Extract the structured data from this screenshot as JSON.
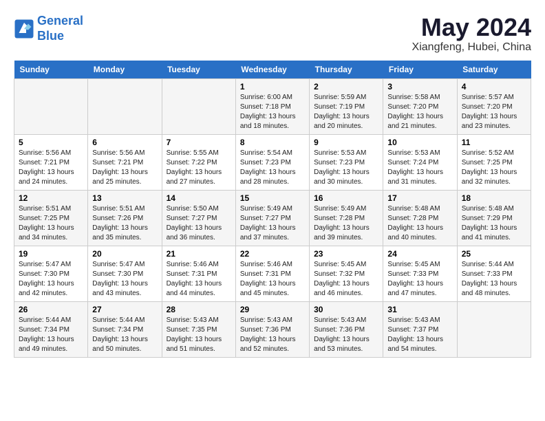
{
  "logo": {
    "line1": "General",
    "line2": "Blue"
  },
  "title": "May 2024",
  "subtitle": "Xiangfeng, Hubei, China",
  "weekdays": [
    "Sunday",
    "Monday",
    "Tuesday",
    "Wednesday",
    "Thursday",
    "Friday",
    "Saturday"
  ],
  "weeks": [
    [
      {
        "day": "",
        "sunrise": "",
        "sunset": "",
        "daylight": ""
      },
      {
        "day": "",
        "sunrise": "",
        "sunset": "",
        "daylight": ""
      },
      {
        "day": "",
        "sunrise": "",
        "sunset": "",
        "daylight": ""
      },
      {
        "day": "1",
        "sunrise": "Sunrise: 6:00 AM",
        "sunset": "Sunset: 7:18 PM",
        "daylight": "Daylight: 13 hours and 18 minutes."
      },
      {
        "day": "2",
        "sunrise": "Sunrise: 5:59 AM",
        "sunset": "Sunset: 7:19 PM",
        "daylight": "Daylight: 13 hours and 20 minutes."
      },
      {
        "day": "3",
        "sunrise": "Sunrise: 5:58 AM",
        "sunset": "Sunset: 7:20 PM",
        "daylight": "Daylight: 13 hours and 21 minutes."
      },
      {
        "day": "4",
        "sunrise": "Sunrise: 5:57 AM",
        "sunset": "Sunset: 7:20 PM",
        "daylight": "Daylight: 13 hours and 23 minutes."
      }
    ],
    [
      {
        "day": "5",
        "sunrise": "Sunrise: 5:56 AM",
        "sunset": "Sunset: 7:21 PM",
        "daylight": "Daylight: 13 hours and 24 minutes."
      },
      {
        "day": "6",
        "sunrise": "Sunrise: 5:56 AM",
        "sunset": "Sunset: 7:21 PM",
        "daylight": "Daylight: 13 hours and 25 minutes."
      },
      {
        "day": "7",
        "sunrise": "Sunrise: 5:55 AM",
        "sunset": "Sunset: 7:22 PM",
        "daylight": "Daylight: 13 hours and 27 minutes."
      },
      {
        "day": "8",
        "sunrise": "Sunrise: 5:54 AM",
        "sunset": "Sunset: 7:23 PM",
        "daylight": "Daylight: 13 hours and 28 minutes."
      },
      {
        "day": "9",
        "sunrise": "Sunrise: 5:53 AM",
        "sunset": "Sunset: 7:23 PM",
        "daylight": "Daylight: 13 hours and 30 minutes."
      },
      {
        "day": "10",
        "sunrise": "Sunrise: 5:53 AM",
        "sunset": "Sunset: 7:24 PM",
        "daylight": "Daylight: 13 hours and 31 minutes."
      },
      {
        "day": "11",
        "sunrise": "Sunrise: 5:52 AM",
        "sunset": "Sunset: 7:25 PM",
        "daylight": "Daylight: 13 hours and 32 minutes."
      }
    ],
    [
      {
        "day": "12",
        "sunrise": "Sunrise: 5:51 AM",
        "sunset": "Sunset: 7:25 PM",
        "daylight": "Daylight: 13 hours and 34 minutes."
      },
      {
        "day": "13",
        "sunrise": "Sunrise: 5:51 AM",
        "sunset": "Sunset: 7:26 PM",
        "daylight": "Daylight: 13 hours and 35 minutes."
      },
      {
        "day": "14",
        "sunrise": "Sunrise: 5:50 AM",
        "sunset": "Sunset: 7:27 PM",
        "daylight": "Daylight: 13 hours and 36 minutes."
      },
      {
        "day": "15",
        "sunrise": "Sunrise: 5:49 AM",
        "sunset": "Sunset: 7:27 PM",
        "daylight": "Daylight: 13 hours and 37 minutes."
      },
      {
        "day": "16",
        "sunrise": "Sunrise: 5:49 AM",
        "sunset": "Sunset: 7:28 PM",
        "daylight": "Daylight: 13 hours and 39 minutes."
      },
      {
        "day": "17",
        "sunrise": "Sunrise: 5:48 AM",
        "sunset": "Sunset: 7:28 PM",
        "daylight": "Daylight: 13 hours and 40 minutes."
      },
      {
        "day": "18",
        "sunrise": "Sunrise: 5:48 AM",
        "sunset": "Sunset: 7:29 PM",
        "daylight": "Daylight: 13 hours and 41 minutes."
      }
    ],
    [
      {
        "day": "19",
        "sunrise": "Sunrise: 5:47 AM",
        "sunset": "Sunset: 7:30 PM",
        "daylight": "Daylight: 13 hours and 42 minutes."
      },
      {
        "day": "20",
        "sunrise": "Sunrise: 5:47 AM",
        "sunset": "Sunset: 7:30 PM",
        "daylight": "Daylight: 13 hours and 43 minutes."
      },
      {
        "day": "21",
        "sunrise": "Sunrise: 5:46 AM",
        "sunset": "Sunset: 7:31 PM",
        "daylight": "Daylight: 13 hours and 44 minutes."
      },
      {
        "day": "22",
        "sunrise": "Sunrise: 5:46 AM",
        "sunset": "Sunset: 7:31 PM",
        "daylight": "Daylight: 13 hours and 45 minutes."
      },
      {
        "day": "23",
        "sunrise": "Sunrise: 5:45 AM",
        "sunset": "Sunset: 7:32 PM",
        "daylight": "Daylight: 13 hours and 46 minutes."
      },
      {
        "day": "24",
        "sunrise": "Sunrise: 5:45 AM",
        "sunset": "Sunset: 7:33 PM",
        "daylight": "Daylight: 13 hours and 47 minutes."
      },
      {
        "day": "25",
        "sunrise": "Sunrise: 5:44 AM",
        "sunset": "Sunset: 7:33 PM",
        "daylight": "Daylight: 13 hours and 48 minutes."
      }
    ],
    [
      {
        "day": "26",
        "sunrise": "Sunrise: 5:44 AM",
        "sunset": "Sunset: 7:34 PM",
        "daylight": "Daylight: 13 hours and 49 minutes."
      },
      {
        "day": "27",
        "sunrise": "Sunrise: 5:44 AM",
        "sunset": "Sunset: 7:34 PM",
        "daylight": "Daylight: 13 hours and 50 minutes."
      },
      {
        "day": "28",
        "sunrise": "Sunrise: 5:43 AM",
        "sunset": "Sunset: 7:35 PM",
        "daylight": "Daylight: 13 hours and 51 minutes."
      },
      {
        "day": "29",
        "sunrise": "Sunrise: 5:43 AM",
        "sunset": "Sunset: 7:36 PM",
        "daylight": "Daylight: 13 hours and 52 minutes."
      },
      {
        "day": "30",
        "sunrise": "Sunrise: 5:43 AM",
        "sunset": "Sunset: 7:36 PM",
        "daylight": "Daylight: 13 hours and 53 minutes."
      },
      {
        "day": "31",
        "sunrise": "Sunrise: 5:43 AM",
        "sunset": "Sunset: 7:37 PM",
        "daylight": "Daylight: 13 hours and 54 minutes."
      },
      {
        "day": "",
        "sunrise": "",
        "sunset": "",
        "daylight": ""
      }
    ]
  ]
}
